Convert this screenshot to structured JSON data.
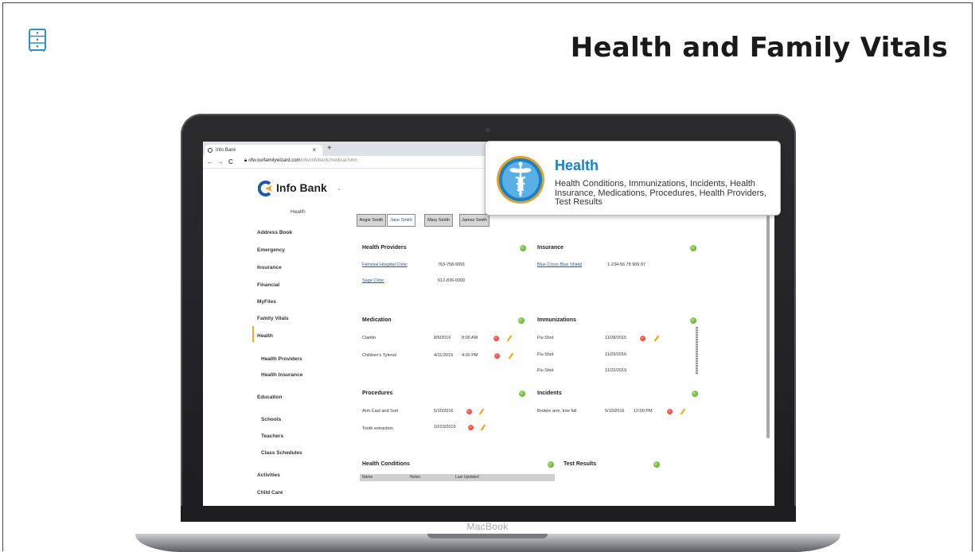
{
  "slide": {
    "title": "Health and Family Vitals",
    "icon": "file-cabinet-icon"
  },
  "laptop": {
    "brand": "MacBook"
  },
  "browser": {
    "tab_title": "Info Bank",
    "tab_close": "×",
    "new_tab": "+",
    "url_host": "ofw.ourfamilywizard.com",
    "url_path": "/ofw/infobank/medical form",
    "back": "←",
    "forward": "→",
    "reload": "C"
  },
  "app": {
    "title": "Info Bank",
    "caret": "⌄",
    "sidebar": {
      "header": "Health",
      "items": [
        "Address Book",
        "Emergency",
        "Insurance",
        "Financial",
        "MyFiles",
        "Family Vitals",
        "Health",
        "Health Providers",
        "Health Insurance",
        "Education",
        "Schools",
        "Teachers",
        "Class Schedules",
        "Activities",
        "Child Care"
      ]
    },
    "person_tabs": [
      "Angie Smith",
      "Jane Smith",
      "Mary Smith",
      "James Smith"
    ],
    "sections": {
      "health_providers": {
        "title": "Health Providers",
        "rows": [
          {
            "name": "Fairview Hospital Clinic",
            "phone": "763-758-9991"
          },
          {
            "name": "Sage Clinic",
            "phone": "612-836-0000"
          }
        ]
      },
      "insurance": {
        "title": "Insurance",
        "rows": [
          {
            "name": "Blue Cross Blue Shield",
            "phone": "1-234-56 78 909 87"
          }
        ]
      },
      "medication": {
        "title": "Medication",
        "rows": [
          {
            "name": "Claritin",
            "date": "8/6/2016",
            "time": "8:00 AM"
          },
          {
            "name": "Children's Tylenol",
            "date": "4/11/2019",
            "time": "4:00 PM"
          }
        ]
      },
      "immunizations": {
        "title": "Immunizations",
        "rows": [
          {
            "name": "Flu Shot",
            "date": "11/28/2015"
          },
          {
            "name": "Flu Shot",
            "date": "11/29/2016"
          },
          {
            "name": "Flu Shot",
            "date": "11/22/2019"
          }
        ]
      },
      "procedures": {
        "title": "Procedures",
        "rows": [
          {
            "name": "Arm Cast and Sort",
            "date": "5/10/2016"
          },
          {
            "name": "Tooth extraction",
            "date": "10/23/2019"
          }
        ]
      },
      "incidents": {
        "title": "Incidents",
        "rows": [
          {
            "name": "Broken arm, tree fall",
            "date": "5/10/2016",
            "time": "12:00 PM"
          }
        ]
      },
      "health_conditions": {
        "title": "Health Conditions",
        "columns": [
          "Name",
          "Notes",
          "Last Updated"
        ]
      },
      "test_results": {
        "title": "Test Results"
      }
    }
  },
  "callout": {
    "title": "Health",
    "description": "Health Conditions, Immunizations, Incidents, Health Insurance, Medications, Procedures, Health Providers, Test Results",
    "icon": "caduceus-icon"
  },
  "colors": {
    "callout_title": "#1b7fc2",
    "link": "#1a55c8",
    "add_green": "#4e9a24",
    "delete_red": "#dd2222",
    "edit_yellow": "#e6a817",
    "active_bar": "#e9a83d"
  }
}
